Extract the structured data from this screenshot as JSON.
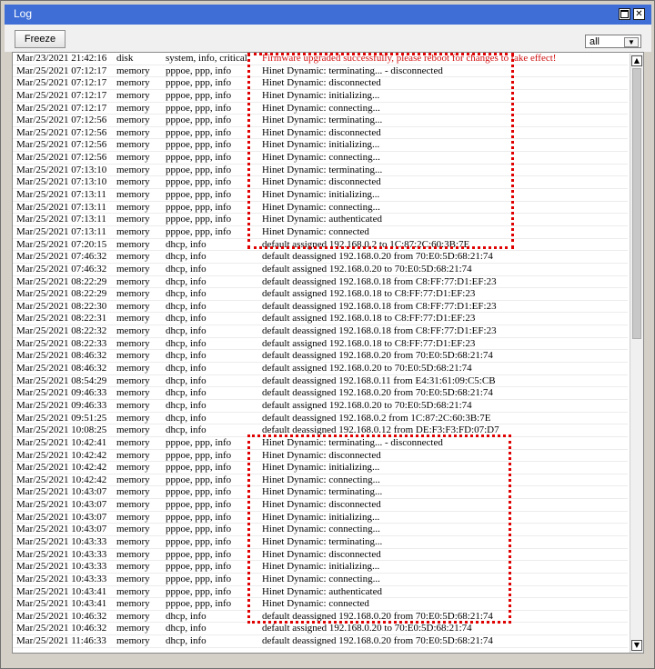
{
  "window": {
    "title": "Log"
  },
  "toolbar": {
    "freeze_label": "Freeze",
    "filter_value": "all"
  },
  "entries": [
    [
      "Mar/23/2021 21:42:16",
      "disk",
      "system, info, critical",
      "Firmware upgraded successfully, please reboot for changes to take effect!"
    ],
    [
      "Mar/25/2021 07:12:17",
      "memory",
      "pppoe, ppp, info",
      "Hinet Dynamic: terminating... - disconnected"
    ],
    [
      "Mar/25/2021 07:12:17",
      "memory",
      "pppoe, ppp, info",
      "Hinet Dynamic: disconnected"
    ],
    [
      "Mar/25/2021 07:12:17",
      "memory",
      "pppoe, ppp, info",
      "Hinet Dynamic: initializing..."
    ],
    [
      "Mar/25/2021 07:12:17",
      "memory",
      "pppoe, ppp, info",
      "Hinet Dynamic: connecting..."
    ],
    [
      "Mar/25/2021 07:12:56",
      "memory",
      "pppoe, ppp, info",
      "Hinet Dynamic: terminating..."
    ],
    [
      "Mar/25/2021 07:12:56",
      "memory",
      "pppoe, ppp, info",
      "Hinet Dynamic: disconnected"
    ],
    [
      "Mar/25/2021 07:12:56",
      "memory",
      "pppoe, ppp, info",
      "Hinet Dynamic: initializing..."
    ],
    [
      "Mar/25/2021 07:12:56",
      "memory",
      "pppoe, ppp, info",
      "Hinet Dynamic: connecting..."
    ],
    [
      "Mar/25/2021 07:13:10",
      "memory",
      "pppoe, ppp, info",
      "Hinet Dynamic: terminating..."
    ],
    [
      "Mar/25/2021 07:13:10",
      "memory",
      "pppoe, ppp, info",
      "Hinet Dynamic: disconnected"
    ],
    [
      "Mar/25/2021 07:13:11",
      "memory",
      "pppoe, ppp, info",
      "Hinet Dynamic: initializing..."
    ],
    [
      "Mar/25/2021 07:13:11",
      "memory",
      "pppoe, ppp, info",
      "Hinet Dynamic: connecting..."
    ],
    [
      "Mar/25/2021 07:13:11",
      "memory",
      "pppoe, ppp, info",
      "Hinet Dynamic: authenticated"
    ],
    [
      "Mar/25/2021 07:13:11",
      "memory",
      "pppoe, ppp, info",
      "Hinet Dynamic: connected"
    ],
    [
      "Mar/25/2021 07:20:15",
      "memory",
      "dhcp, info",
      "default assigned 192.168.0.2 to 1C:87:2C:60:3B:7E"
    ],
    [
      "Mar/25/2021 07:46:32",
      "memory",
      "dhcp, info",
      "default deassigned 192.168.0.20 from 70:E0:5D:68:21:74"
    ],
    [
      "Mar/25/2021 07:46:32",
      "memory",
      "dhcp, info",
      "default assigned 192.168.0.20 to 70:E0:5D:68:21:74"
    ],
    [
      "Mar/25/2021 08:22:29",
      "memory",
      "dhcp, info",
      "default deassigned 192.168.0.18 from C8:FF:77:D1:EF:23"
    ],
    [
      "Mar/25/2021 08:22:29",
      "memory",
      "dhcp, info",
      "default assigned 192.168.0.18 to C8:FF:77:D1:EF:23"
    ],
    [
      "Mar/25/2021 08:22:30",
      "memory",
      "dhcp, info",
      "default deassigned 192.168.0.18 from C8:FF:77:D1:EF:23"
    ],
    [
      "Mar/25/2021 08:22:31",
      "memory",
      "dhcp, info",
      "default assigned 192.168.0.18 to C8:FF:77:D1:EF:23"
    ],
    [
      "Mar/25/2021 08:22:32",
      "memory",
      "dhcp, info",
      "default deassigned 192.168.0.18 from C8:FF:77:D1:EF:23"
    ],
    [
      "Mar/25/2021 08:22:33",
      "memory",
      "dhcp, info",
      "default assigned 192.168.0.18 to C8:FF:77:D1:EF:23"
    ],
    [
      "Mar/25/2021 08:46:32",
      "memory",
      "dhcp, info",
      "default deassigned 192.168.0.20 from 70:E0:5D:68:21:74"
    ],
    [
      "Mar/25/2021 08:46:32",
      "memory",
      "dhcp, info",
      "default assigned 192.168.0.20 to 70:E0:5D:68:21:74"
    ],
    [
      "Mar/25/2021 08:54:29",
      "memory",
      "dhcp, info",
      "default deassigned 192.168.0.11 from E4:31:61:09:C5:CB"
    ],
    [
      "Mar/25/2021 09:46:33",
      "memory",
      "dhcp, info",
      "default deassigned 192.168.0.20 from 70:E0:5D:68:21:74"
    ],
    [
      "Mar/25/2021 09:46:33",
      "memory",
      "dhcp, info",
      "default assigned 192.168.0.20 to 70:E0:5D:68:21:74"
    ],
    [
      "Mar/25/2021 09:51:25",
      "memory",
      "dhcp, info",
      "default deassigned 192.168.0.2 from 1C:87:2C:60:3B:7E"
    ],
    [
      "Mar/25/2021 10:08:25",
      "memory",
      "dhcp, info",
      "default deassigned 192.168.0.12 from DE:F3:F3:FD:07:D7"
    ],
    [
      "Mar/25/2021 10:42:41",
      "memory",
      "pppoe, ppp, info",
      "Hinet Dynamic: terminating... - disconnected"
    ],
    [
      "Mar/25/2021 10:42:42",
      "memory",
      "pppoe, ppp, info",
      "Hinet Dynamic: disconnected"
    ],
    [
      "Mar/25/2021 10:42:42",
      "memory",
      "pppoe, ppp, info",
      "Hinet Dynamic: initializing..."
    ],
    [
      "Mar/25/2021 10:42:42",
      "memory",
      "pppoe, ppp, info",
      "Hinet Dynamic: connecting..."
    ],
    [
      "Mar/25/2021 10:43:07",
      "memory",
      "pppoe, ppp, info",
      "Hinet Dynamic: terminating..."
    ],
    [
      "Mar/25/2021 10:43:07",
      "memory",
      "pppoe, ppp, info",
      "Hinet Dynamic: disconnected"
    ],
    [
      "Mar/25/2021 10:43:07",
      "memory",
      "pppoe, ppp, info",
      "Hinet Dynamic: initializing..."
    ],
    [
      "Mar/25/2021 10:43:07",
      "memory",
      "pppoe, ppp, info",
      "Hinet Dynamic: connecting..."
    ],
    [
      "Mar/25/2021 10:43:33",
      "memory",
      "pppoe, ppp, info",
      "Hinet Dynamic: terminating..."
    ],
    [
      "Mar/25/2021 10:43:33",
      "memory",
      "pppoe, ppp, info",
      "Hinet Dynamic: disconnected"
    ],
    [
      "Mar/25/2021 10:43:33",
      "memory",
      "pppoe, ppp, info",
      "Hinet Dynamic: initializing..."
    ],
    [
      "Mar/25/2021 10:43:33",
      "memory",
      "pppoe, ppp, info",
      "Hinet Dynamic: connecting..."
    ],
    [
      "Mar/25/2021 10:43:41",
      "memory",
      "pppoe, ppp, info",
      "Hinet Dynamic: authenticated"
    ],
    [
      "Mar/25/2021 10:43:41",
      "memory",
      "pppoe, ppp, info",
      "Hinet Dynamic: connected"
    ],
    [
      "Mar/25/2021 10:46:32",
      "memory",
      "dhcp, info",
      "default deassigned 192.168.0.20 from 70:E0:5D:68:21:74"
    ],
    [
      "Mar/25/2021 10:46:32",
      "memory",
      "dhcp, info",
      "default assigned 192.168.0.20 to 70:E0:5D:68:21:74"
    ],
    [
      "Mar/25/2021 11:46:33",
      "memory",
      "dhcp, info",
      "default deassigned 192.168.0.20 from 70:E0:5D:68:21:74"
    ]
  ],
  "critical_row_indexes": [
    0
  ],
  "colors": {
    "titlebar": "#3f6ed7",
    "critical_text": "#d01010",
    "highlight": "#e00000"
  }
}
